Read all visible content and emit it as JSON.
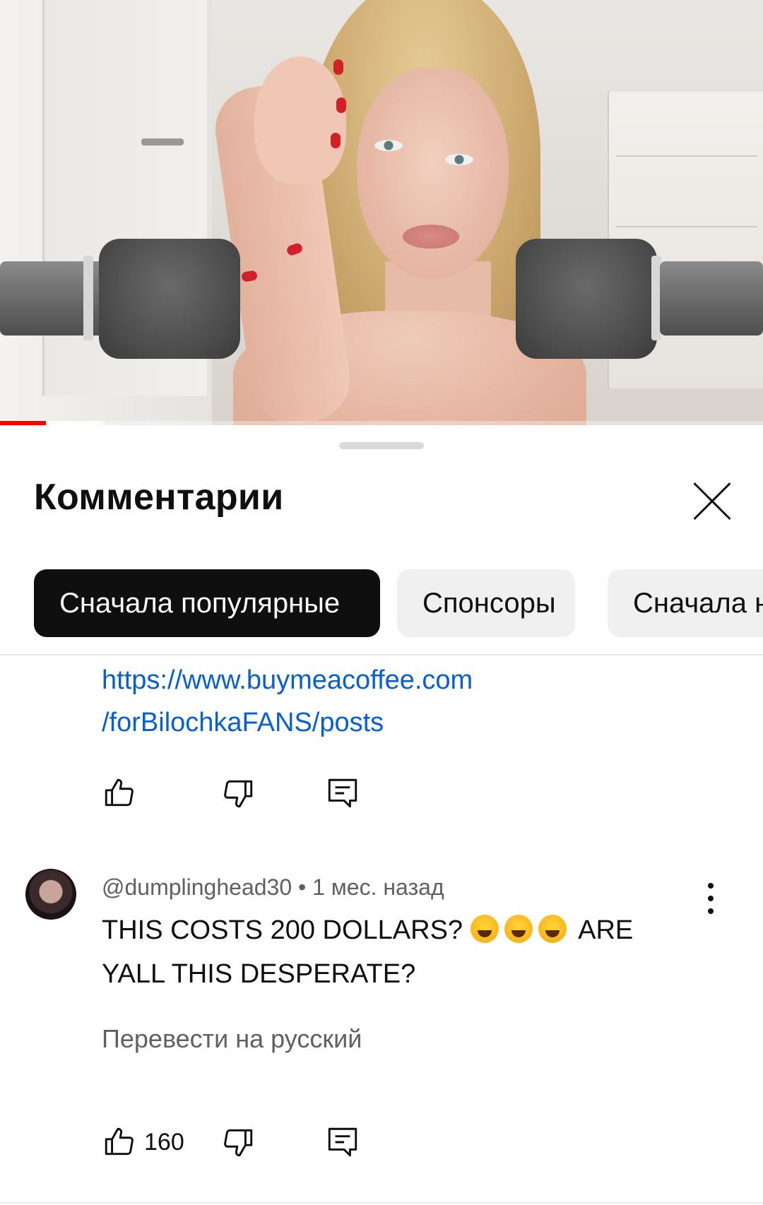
{
  "video": {
    "progress_played": 0.06,
    "progress_buffered": 0.135
  },
  "comments_panel": {
    "title": "Комментарии",
    "close_label": "×",
    "sort_chips": [
      {
        "label": "Сначала популярные",
        "selected": true
      },
      {
        "label": "Спонсоры",
        "selected": false
      },
      {
        "label": "Сначала новые",
        "selected": false
      }
    ]
  },
  "previous_comment": {
    "link_line1": "https://www.buymeacoffee.com",
    "link_line2": "/forBilochkaFANS/posts",
    "like_icon": "thumbs-up-icon",
    "dislike_icon": "thumbs-down-icon",
    "reply_icon": "reply-comment-icon"
  },
  "comment": {
    "author": "@dumplinghead30",
    "separator": " • ",
    "time": "1 мес. назад",
    "text_part1": "THIS COSTS 200 DOLLARS?",
    "emoji_count": 3,
    "emoji_name": "rolling-on-floor-laughing-emoji",
    "text_part2": "ARE YALL THIS DESPERATE?",
    "translate_label": "Перевести на русский",
    "likes": "160",
    "more_icon": "more-vertical-icon"
  },
  "colors": {
    "link": "#065fd4",
    "secondary_text": "#606060",
    "chip_active_bg": "#0f0f0f",
    "chip_bg": "#f0f0f0",
    "progress": "#ff0000"
  }
}
